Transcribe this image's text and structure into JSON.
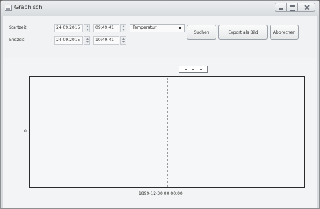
{
  "window": {
    "title": "Graphisch"
  },
  "form": {
    "start_label": "Startzeit:",
    "end_label": "Endzeit:",
    "start_date": "24.09.2015",
    "start_time": "09:49:41",
    "end_date": "24.09.2015",
    "end_time": "10:49:41",
    "measure_selected": "Temperatur"
  },
  "buttons": {
    "search": "Suchen",
    "export": "Export als Bild",
    "cancel": "Abbrechen"
  },
  "chart_data": {
    "type": "line",
    "title": "",
    "xlabel": "",
    "ylabel": "",
    "x_tick_labels": [
      "1899-12-30 00:00:00"
    ],
    "y_tick_labels": [
      "0"
    ],
    "series": [],
    "grid": true
  }
}
